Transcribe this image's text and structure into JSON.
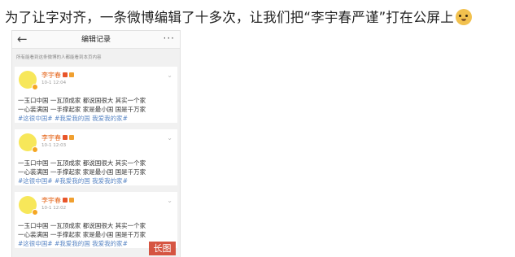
{
  "post": {
    "headline": "为了让字对齐，一条微博编辑了十多次，让我们把“李宇春严谨”打在公屏上",
    "emoji_icon": "doge-icon"
  },
  "screen": {
    "nav": {
      "back_icon": "←",
      "title": "编辑记录",
      "more_icon": "···"
    },
    "notice": "所有能看到这条微博的人都能看到本页内容",
    "records": [
      {
        "username": "李宇春",
        "timestamp": "10-1 12:04",
        "line1": "一玉口中国 一瓦顶成家 都说国很大 其实一个家",
        "line2": "一心装满国 一手撑起家 家是最小国 国是千万家",
        "tags": "#这很中国# #我爱我的国 我爱我的家#"
      },
      {
        "username": "李宇春",
        "timestamp": "10-1 12:03",
        "line1": "一玉口中国 一瓦顶成家 都说国很大 其实一个家",
        "line2": "一心装满国 一手撑起家  家是最小国  国是千万家",
        "tags": "#这很中国# #我爱我的国 我爱我的家#"
      },
      {
        "username": "李宇春",
        "timestamp": "10-1 12:02",
        "line1": "一玉口中国 一瓦顶成家 都说国很大 其实一个家",
        "line2": "一心装满国 一手撑起家 家是最小国 国是千万家",
        "tags": "#这很中国# #我爱我的国 我爱我的家#"
      }
    ]
  },
  "long_image_badge": "长图"
}
